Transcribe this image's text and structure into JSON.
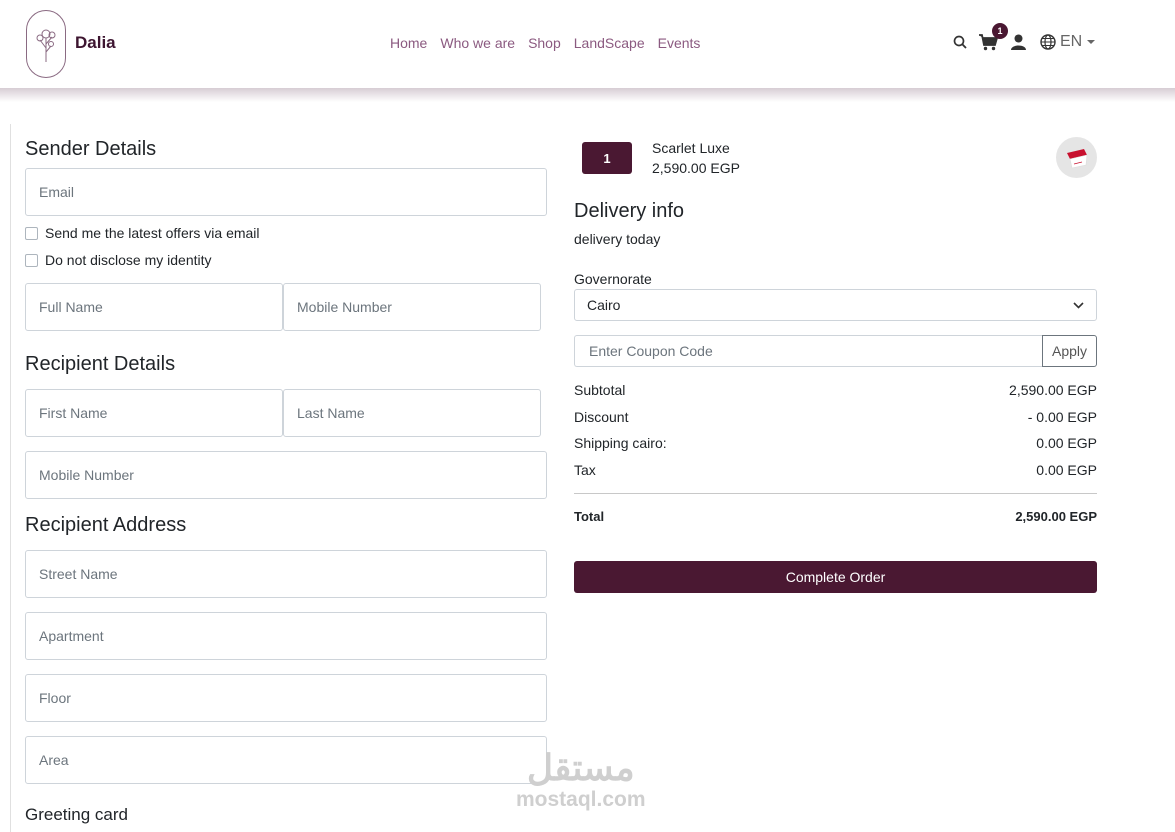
{
  "header": {
    "brand": "Dalia",
    "nav": [
      "Home",
      "Who we are",
      "Shop",
      "LandScape",
      "Events"
    ],
    "cart_count": "1",
    "language": "EN"
  },
  "sender": {
    "title": "Sender Details",
    "email_placeholder": "Email",
    "offers_label": "Send me the latest offers via email",
    "anon_label": "Do not disclose my identity",
    "fullname_placeholder": "Full Name",
    "mobile_placeholder": "Mobile Number"
  },
  "recipient": {
    "title": "Recipient Details",
    "firstname_placeholder": "First Name",
    "lastname_placeholder": "Last Name",
    "mobile_placeholder": "Mobile Number"
  },
  "address": {
    "title": "Recipient Address",
    "street_placeholder": "Street Name",
    "apartment_placeholder": "Apartment",
    "floor_placeholder": "Floor",
    "area_placeholder": "Area"
  },
  "greeting": {
    "title": "Greeting card"
  },
  "order": {
    "quantity": "1",
    "product_name": "Scarlet Luxe",
    "product_price": "2,590.00 EGP",
    "delivery_title": "Delivery info",
    "delivery_note": "delivery today",
    "governorate_label": "Governorate",
    "governorate_value": "Cairo",
    "coupon_placeholder": "Enter Coupon Code",
    "apply_label": "Apply",
    "subtotal_label": "Subtotal",
    "subtotal_value": "2,590.00 EGP",
    "discount_label": "Discount",
    "discount_value": "- 0.00 EGP",
    "shipping_label": "Shipping cairo:",
    "shipping_value": "0.00 EGP",
    "tax_label": "Tax",
    "tax_value": "0.00 EGP",
    "total_label": "Total",
    "total_value": "2,590.00 EGP",
    "complete_label": "Complete Order"
  },
  "watermark": {
    "arabic": "مستقل",
    "latin": "mostaql.com"
  },
  "colors": {
    "primary": "#4a1832",
    "nav": "#8b5a80"
  }
}
